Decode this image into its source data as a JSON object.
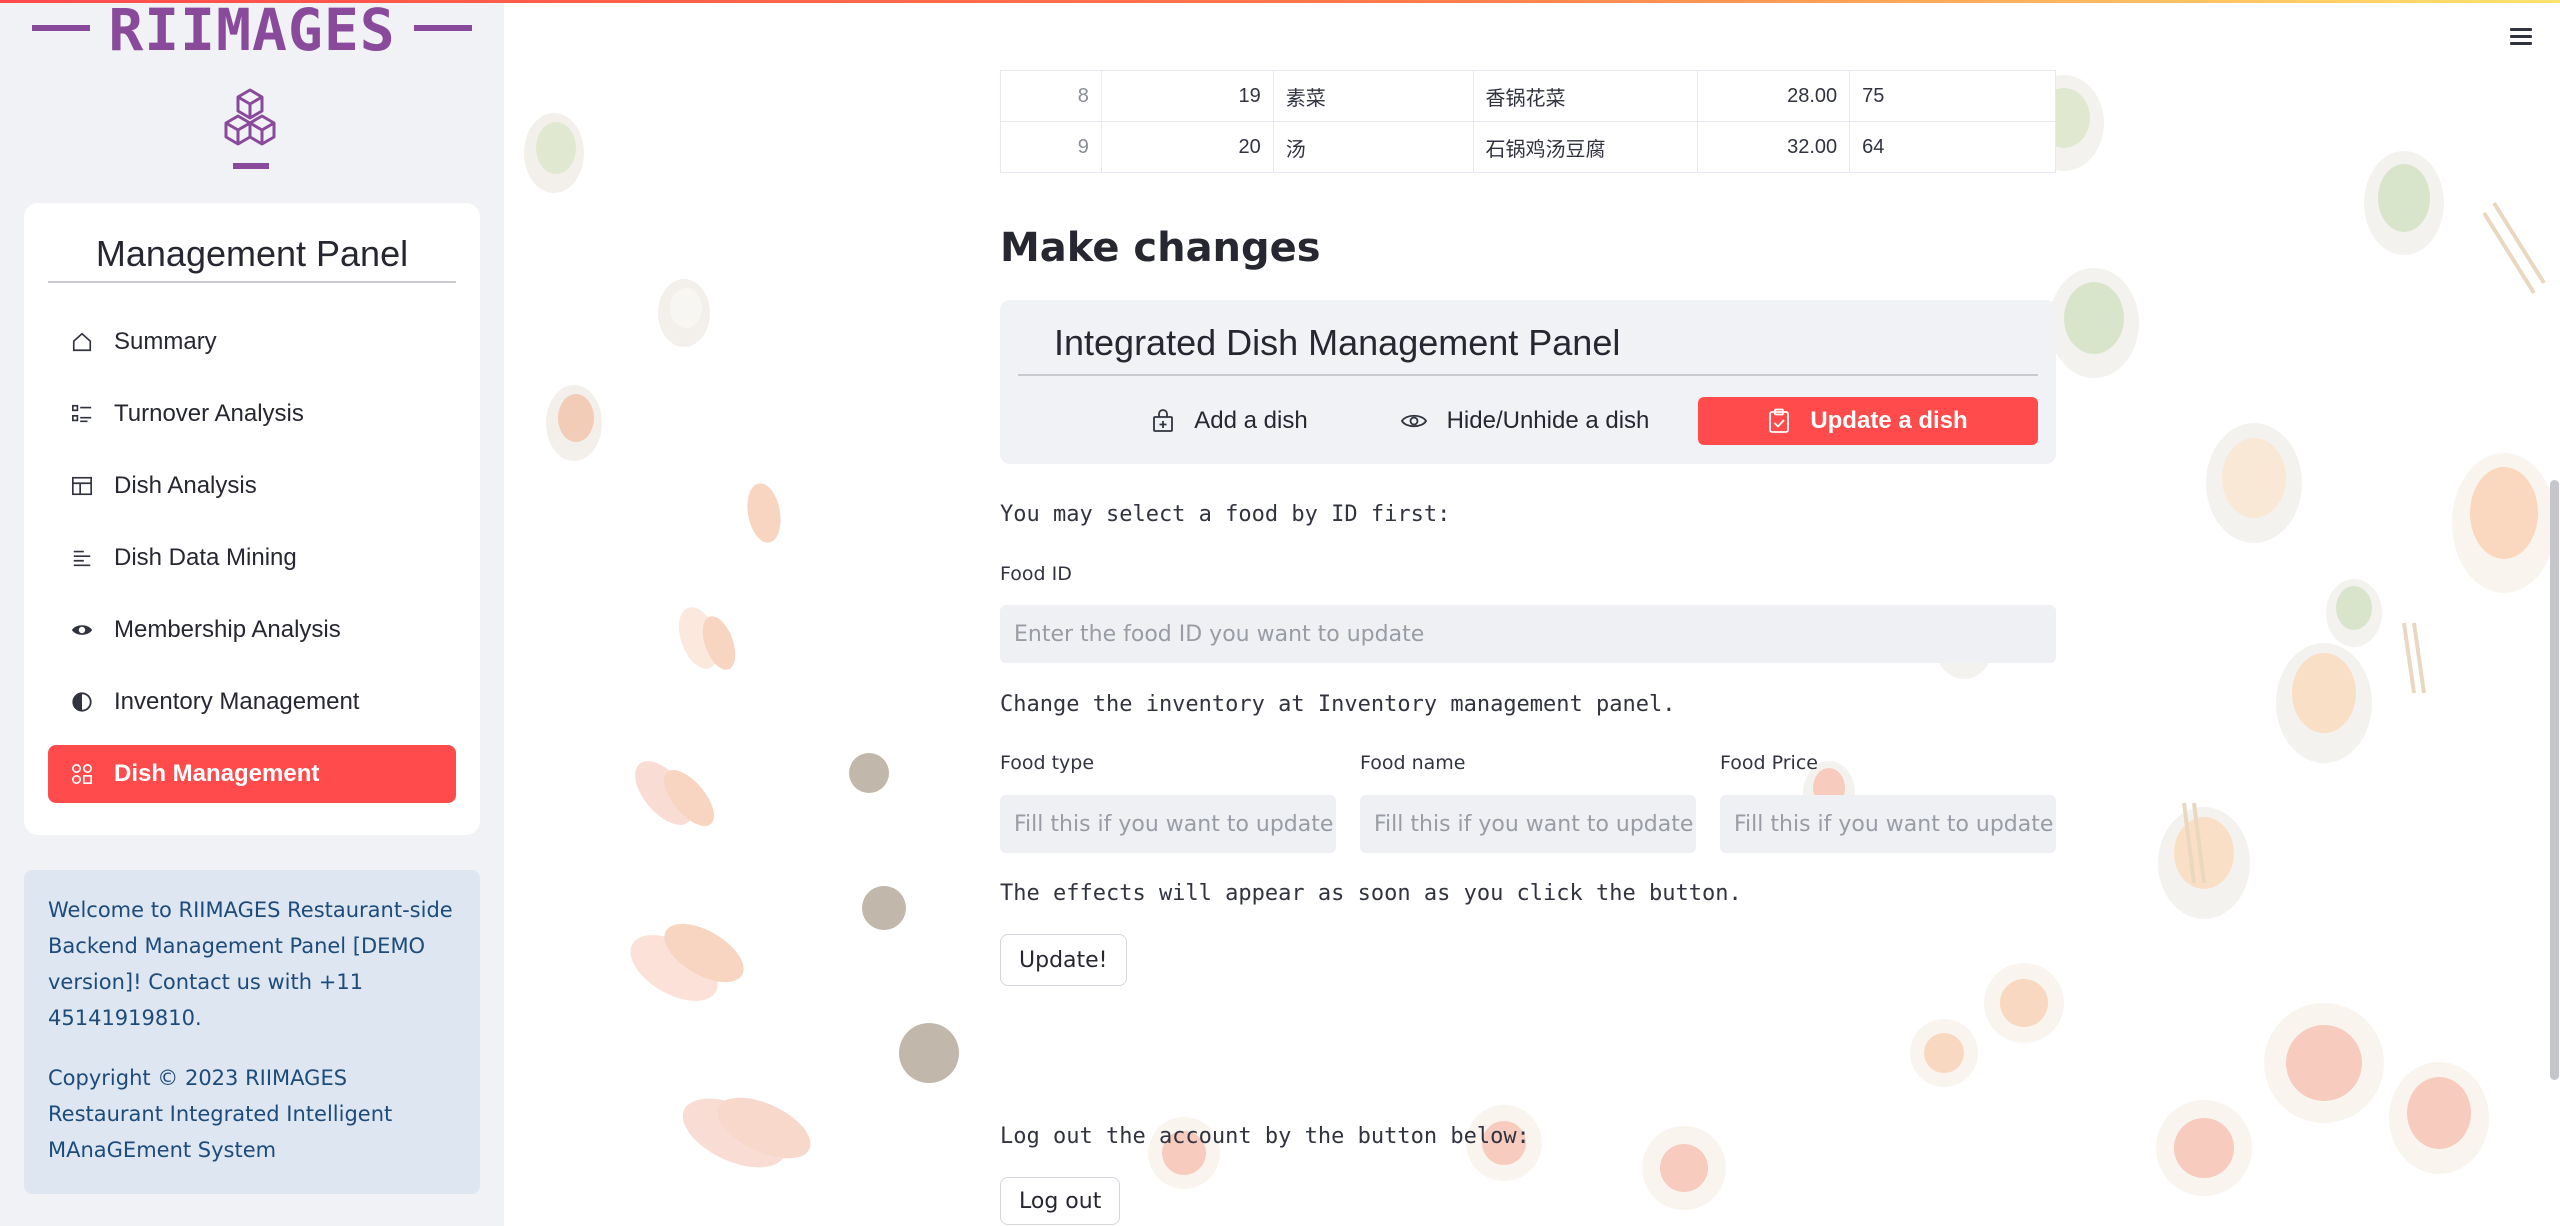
{
  "logo": {
    "text": "RIIMAGES"
  },
  "sidebar": {
    "title": "Management Panel",
    "items": [
      {
        "label": "Summary",
        "icon": "house-icon"
      },
      {
        "label": "Turnover Analysis",
        "icon": "list-check-icon"
      },
      {
        "label": "Dish Analysis",
        "icon": "layout-icon"
      },
      {
        "label": "Dish Data Mining",
        "icon": "text-lines-icon"
      },
      {
        "label": "Membership Analysis",
        "icon": "eye-icon"
      },
      {
        "label": "Inventory Management",
        "icon": "half-circle-icon"
      },
      {
        "label": "Dish Management",
        "icon": "grid-dots-icon",
        "active": true
      }
    ],
    "info": {
      "welcome": "Welcome to RIIMAGES Restaurant-side Backend Management Panel [DEMO version]! Contact us with +11 45141919810.",
      "copyright": "Copyright © 2023 RIIMAGES Restaurant Integrated Intelligent MAnaGEment System"
    }
  },
  "table": {
    "rows": [
      {
        "index": "8",
        "id": "19",
        "type": "素菜",
        "name": "香锅花菜",
        "price": "28.00",
        "stock": "75"
      },
      {
        "index": "9",
        "id": "20",
        "type": "汤",
        "name": "石锅鸡汤豆腐",
        "price": "32.00",
        "stock": "64"
      }
    ]
  },
  "main": {
    "heading": "Make changes",
    "panel": {
      "title": "Integrated Dish Management Panel",
      "tabs": [
        {
          "label": "Add a dish",
          "icon": "bag-plus-icon"
        },
        {
          "label": "Hide/Unhide a dish",
          "icon": "eye-outline-icon"
        },
        {
          "label": "Update a dish",
          "icon": "clipboard-check-icon",
          "active": true
        }
      ]
    },
    "select_hint": "You may select a food by ID first:",
    "food_id": {
      "label": "Food ID",
      "placeholder": "Enter the food ID you want to update"
    },
    "inventory_hint": "Change the inventory at Inventory management panel.",
    "food_type": {
      "label": "Food type",
      "placeholder": "Fill this if you want to update"
    },
    "food_name": {
      "label": "Food name",
      "placeholder": "Fill this if you want to update"
    },
    "food_price": {
      "label": "Food Price",
      "placeholder": "Fill this if you want to update"
    },
    "effects_hint": "The effects will appear as soon as you click the button.",
    "update_button": "Update!",
    "logout_hint": "Log out the account by the button below:",
    "logout_button": "Log out"
  },
  "colors": {
    "accent": "#ff4b4b",
    "brand": "#8a4a9c",
    "sidebar_bg": "#f0f2f6",
    "info_bg": "#dde6f1",
    "info_text": "#1d4b7a"
  }
}
